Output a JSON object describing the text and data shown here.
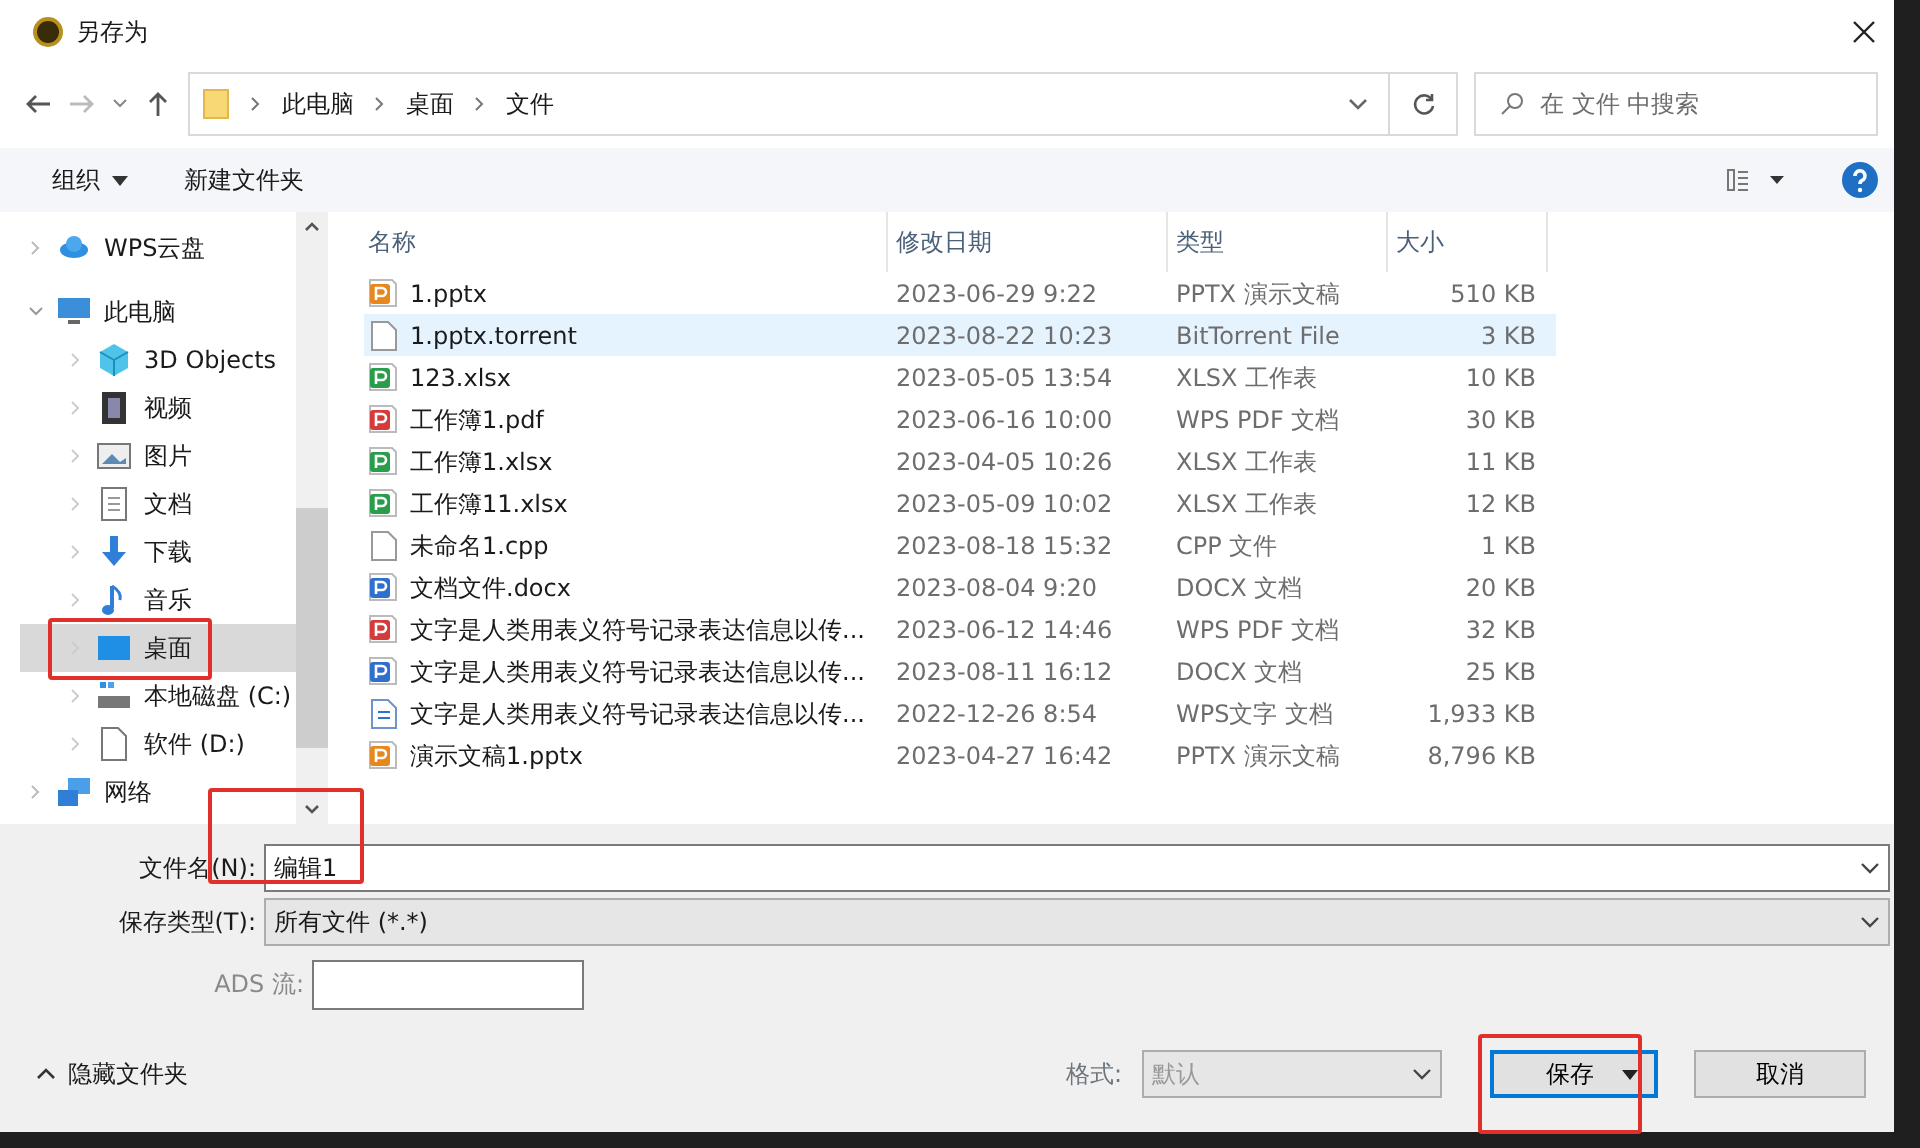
{
  "window": {
    "title": "另存为"
  },
  "address_bar": {
    "path": [
      "此电脑",
      "桌面",
      "文件"
    ]
  },
  "search": {
    "placeholder": "在 文件 中搜索"
  },
  "toolbar": {
    "organize": "组织",
    "new_folder": "新建文件夹"
  },
  "sidebar": {
    "items": [
      {
        "label": "WPS云盘",
        "kind": "cloud",
        "expanded": false,
        "selected": false
      },
      {
        "label": "此电脑",
        "kind": "pc",
        "expanded": true,
        "selected": false,
        "children": [
          {
            "label": "3D Objects",
            "kind": "cube",
            "selected": false
          },
          {
            "label": "视频",
            "kind": "video",
            "selected": false
          },
          {
            "label": "图片",
            "kind": "image",
            "selected": false
          },
          {
            "label": "文档",
            "kind": "doc",
            "selected": false
          },
          {
            "label": "下载",
            "kind": "download",
            "selected": false
          },
          {
            "label": "音乐",
            "kind": "music",
            "selected": false
          },
          {
            "label": "桌面",
            "kind": "desktop",
            "selected": true
          },
          {
            "label": "本地磁盘 (C:)",
            "kind": "disk",
            "selected": false
          },
          {
            "label": "软件 (D:)",
            "kind": "file",
            "selected": false
          }
        ]
      },
      {
        "label": "网络",
        "kind": "network",
        "expanded": false,
        "selected": false
      }
    ]
  },
  "table": {
    "columns": [
      "名称",
      "修改日期",
      "类型",
      "大小"
    ],
    "rows": [
      {
        "name": "1.pptx",
        "date": "2023-06-29 9:22",
        "type": "PPTX 演示文稿",
        "size": "510 KB",
        "kind": "ppt",
        "selected": false
      },
      {
        "name": "1.pptx.torrent",
        "date": "2023-08-22 10:23",
        "type": "BitTorrent File",
        "size": "3 KB",
        "kind": "blank",
        "selected": true
      },
      {
        "name": "123.xlsx",
        "date": "2023-05-05 13:54",
        "type": "XLSX 工作表",
        "size": "10 KB",
        "kind": "xls",
        "selected": false
      },
      {
        "name": "工作簿1.pdf",
        "date": "2023-06-16 10:00",
        "type": "WPS PDF 文档",
        "size": "30 KB",
        "kind": "pdf",
        "selected": false
      },
      {
        "name": "工作簿1.xlsx",
        "date": "2023-04-05 10:26",
        "type": "XLSX 工作表",
        "size": "11 KB",
        "kind": "xls",
        "selected": false
      },
      {
        "name": "工作簿11.xlsx",
        "date": "2023-05-09 10:02",
        "type": "XLSX 工作表",
        "size": "12 KB",
        "kind": "xls",
        "selected": false
      },
      {
        "name": "未命名1.cpp",
        "date": "2023-08-18 15:32",
        "type": "CPP 文件",
        "size": "1 KB",
        "kind": "blank",
        "selected": false
      },
      {
        "name": "文档文件.docx",
        "date": "2023-08-04 9:20",
        "type": "DOCX 文档",
        "size": "20 KB",
        "kind": "doc",
        "selected": false
      },
      {
        "name": "文字是人类用表义符号记录表达信息以传...",
        "date": "2023-06-12 14:46",
        "type": "WPS PDF 文档",
        "size": "32 KB",
        "kind": "pdf",
        "selected": false
      },
      {
        "name": "文字是人类用表义符号记录表达信息以传...",
        "date": "2023-08-11 16:12",
        "type": "DOCX 文档",
        "size": "25 KB",
        "kind": "doc",
        "selected": false
      },
      {
        "name": "文字是人类用表义符号记录表达信息以传...",
        "date": "2022-12-26 8:54",
        "type": "WPS文字 文档",
        "size": "1,933 KB",
        "kind": "text",
        "selected": false
      },
      {
        "name": "演示文稿1.pptx",
        "date": "2023-04-27 16:42",
        "type": "PPTX 演示文稿",
        "size": "8,796 KB",
        "kind": "ppt",
        "selected": false
      }
    ]
  },
  "form": {
    "filename_label": "文件名(N):",
    "filename": "编辑1",
    "type_label": "保存类型(T):",
    "type_value": "所有文件 (*.*)",
    "ads_label": "ADS 流:",
    "format_label": "格式:",
    "format_value": "默认"
  },
  "footer": {
    "hide_folders": "隐藏文件夹",
    "save": "保存",
    "cancel": "取消"
  },
  "annotations": {
    "selected_sidebar_item_boxed": true,
    "sidebar_bottom_boxed": true,
    "save_button_boxed": true
  }
}
